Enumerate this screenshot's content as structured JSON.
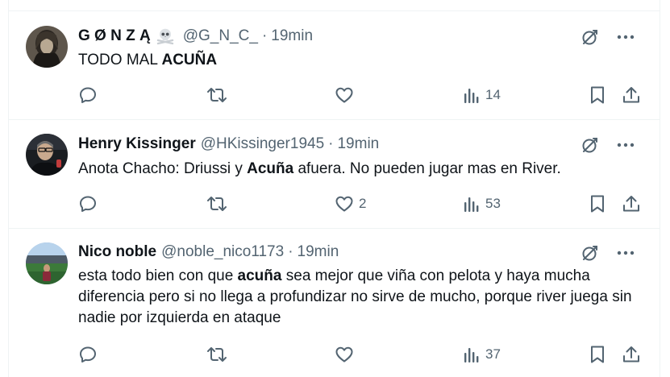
{
  "tweets": [
    {
      "name": "G Ø N Z Ą",
      "emoji": "skull-crossbones",
      "handle": "@G_N_C_",
      "separator": "·",
      "time": "19min",
      "body_parts": [
        "TODO MAL ",
        "ACUÑA",
        ""
      ],
      "replies": "",
      "reposts": "",
      "likes": "",
      "views": "14"
    },
    {
      "name": "Henry Kissinger",
      "handle": "@HKissinger1945",
      "separator": "·",
      "time": "19min",
      "body_parts": [
        "Anota Chacho: Driussi y ",
        "Acuña",
        " afuera. No pueden jugar mas en River."
      ],
      "replies": "",
      "reposts": "",
      "likes": "2",
      "views": "53"
    },
    {
      "name": "Nico noble",
      "handle": "@noble_nico1173",
      "separator": "·",
      "time": "19min",
      "body_parts": [
        "esta todo bien con que ",
        "acuña",
        " sea mejor que viña con pelota y haya mucha diferencia pero si no llega a profundizar no sirve de mucho, porque river juega sin nadie por izquierda en ataque"
      ],
      "replies": "",
      "reposts": "",
      "likes": "",
      "views": "37"
    }
  ],
  "colors": {
    "text": "#0f1419",
    "secondary": "#536471",
    "divider": "#eff3f4"
  }
}
